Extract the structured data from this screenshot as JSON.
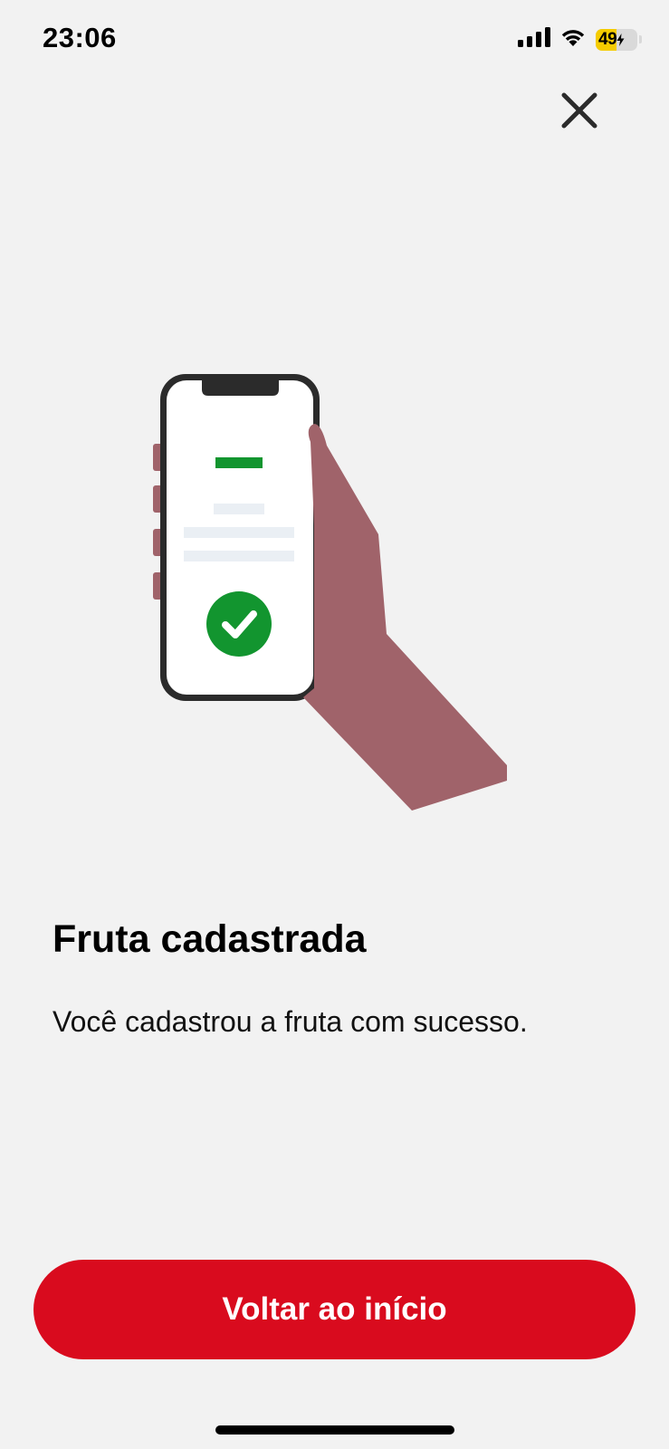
{
  "status_bar": {
    "time": "23:06",
    "battery_level": "49",
    "battery_fraction": 0.49
  },
  "close": {
    "icon": "close-icon"
  },
  "illustration": {
    "icons": [
      "phone-in-hand-illustration",
      "checkmark-icon"
    ],
    "colors": {
      "hand": "#a0636a",
      "check": "#12952f",
      "phone_frame": "#2b2b2b"
    }
  },
  "content": {
    "title": "Fruta cadastrada",
    "message": "Você cadastrou a fruta com sucesso."
  },
  "actions": {
    "back_home_label": "Voltar ao início"
  },
  "colors": {
    "accent": "#d90b1e",
    "background": "#f2f2f2"
  }
}
